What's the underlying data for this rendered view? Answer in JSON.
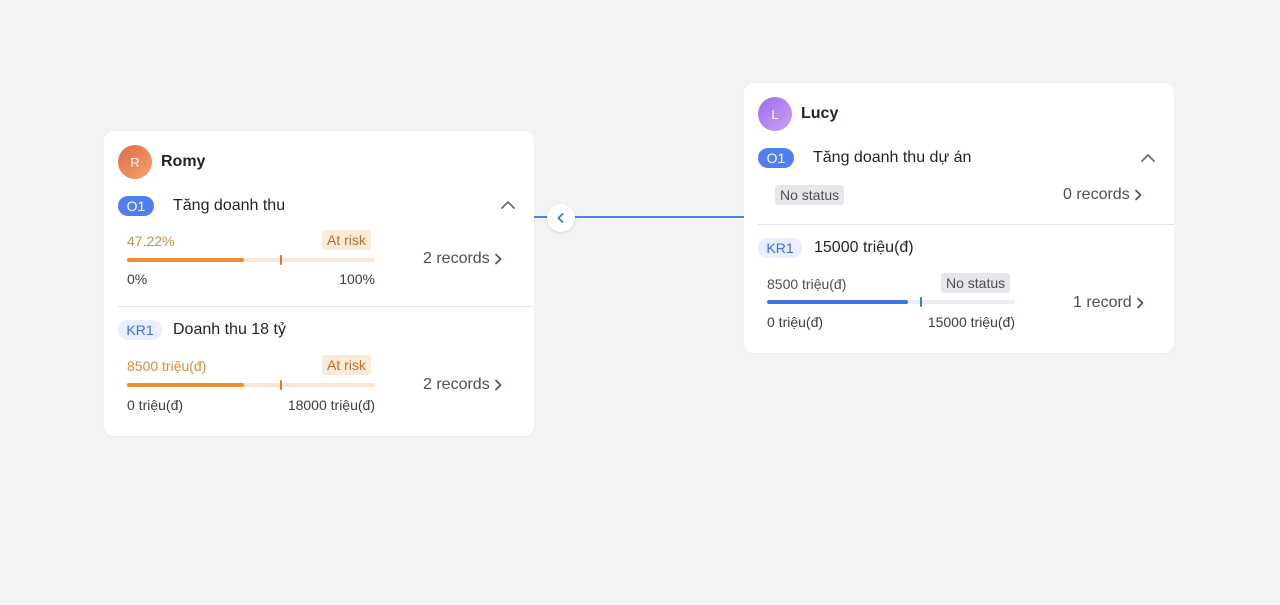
{
  "connector": {
    "collapse_icon": "chevron-left-icon",
    "color": "#4f7ef0"
  },
  "romy": {
    "avatar": "R",
    "name": "Romy",
    "objective": {
      "tag": "O1",
      "title": "Tăng doanh thu",
      "progress_text": "47.22%",
      "progress_fraction": 0.4722,
      "expected_fraction": 0.62,
      "status": "At risk",
      "range_min": "0%",
      "range_max": "100%",
      "records": "2 records"
    },
    "key_result": {
      "tag": "KR1",
      "title": "Doanh thu 18 tỷ",
      "progress_text": "8500 triệu(đ)",
      "progress_fraction": 0.4722,
      "expected_fraction": 0.62,
      "status": "At risk",
      "range_min": "0 triệu(đ)",
      "range_max": "18000 triệu(đ)",
      "records": "2 records"
    }
  },
  "lucy": {
    "avatar": "L",
    "name": "Lucy",
    "objective": {
      "tag": "O1",
      "title": "Tăng doanh thu dự án",
      "status": "No status",
      "records": "0 records"
    },
    "key_result": {
      "tag": "KR1",
      "title": "15000 triệu(đ)",
      "progress_text": "8500 triệu(đ)",
      "progress_fraction": 0.5667,
      "expected_fraction": 0.62,
      "status": "No status",
      "range_min": "0 triệu(đ)",
      "range_max": "15000 triệu(đ)",
      "records": "1 record"
    }
  }
}
